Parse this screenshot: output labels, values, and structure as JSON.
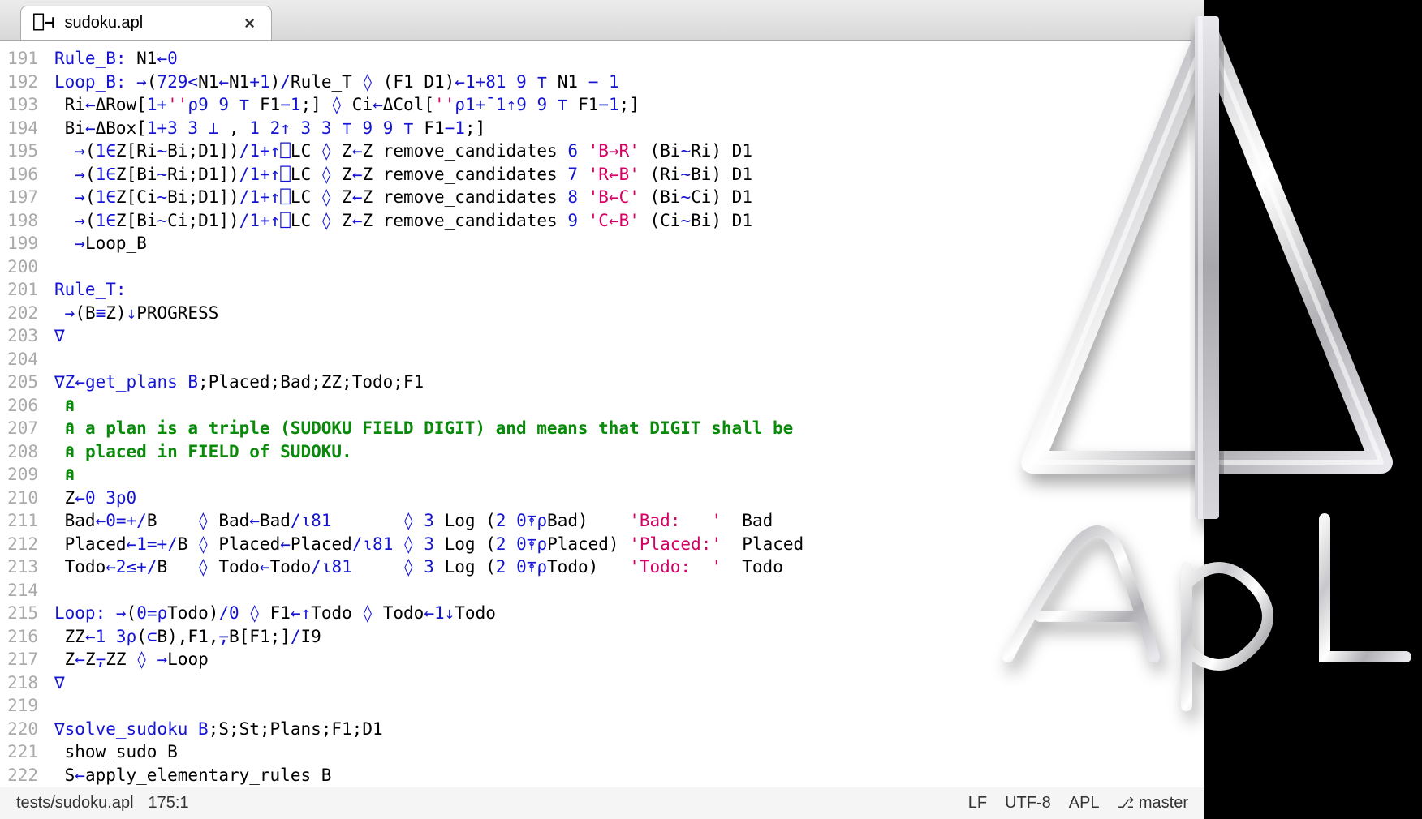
{
  "tab": {
    "icon": "⎕⊣",
    "filename": "sudoku.apl",
    "close": "×"
  },
  "lines": [
    {
      "n": 191,
      "segs": [
        [
          "label",
          "Rule_B:"
        ],
        [
          "plain",
          " N1"
        ],
        [
          "asn",
          "←"
        ],
        [
          "num",
          "0"
        ]
      ]
    },
    {
      "n": 192,
      "segs": [
        [
          "label",
          "Loop_B:"
        ],
        [
          "plain",
          " "
        ],
        [
          "op",
          "→"
        ],
        [
          "plain",
          "("
        ],
        [
          "num",
          "729"
        ],
        [
          "op",
          "<"
        ],
        [
          "plain",
          "N1"
        ],
        [
          "asn",
          "←"
        ],
        [
          "plain",
          "N1"
        ],
        [
          "op",
          "+"
        ],
        [
          "num",
          "1"
        ],
        [
          "plain",
          ")"
        ],
        [
          "op",
          "/"
        ],
        [
          "plain",
          "Rule_T "
        ],
        [
          "op",
          "◊"
        ],
        [
          "plain",
          " (F1 D1)"
        ],
        [
          "asn",
          "←"
        ],
        [
          "num",
          "1"
        ],
        [
          "op",
          "+"
        ],
        [
          "num",
          "81 9 "
        ],
        [
          "op",
          "⊤"
        ],
        [
          "plain",
          " N1 "
        ],
        [
          "op",
          "−"
        ],
        [
          "plain",
          " "
        ],
        [
          "num",
          "1"
        ]
      ]
    },
    {
      "n": 193,
      "segs": [
        [
          "plain",
          " Ri"
        ],
        [
          "asn",
          "←"
        ],
        [
          "plain",
          "ΔRow["
        ],
        [
          "num",
          "1"
        ],
        [
          "op",
          "+"
        ],
        [
          "str",
          "''"
        ],
        [
          "op",
          "⍴"
        ],
        [
          "num",
          "9 9 "
        ],
        [
          "op",
          "⊤"
        ],
        [
          "plain",
          " F1"
        ],
        [
          "op",
          "−"
        ],
        [
          "num",
          "1"
        ],
        [
          "plain",
          ";] "
        ],
        [
          "op",
          "◊"
        ],
        [
          "plain",
          " Ci"
        ],
        [
          "asn",
          "←"
        ],
        [
          "plain",
          "ΔCol["
        ],
        [
          "str",
          "''"
        ],
        [
          "op",
          "⍴"
        ],
        [
          "num",
          "1"
        ],
        [
          "op",
          "+¯"
        ],
        [
          "num",
          "1"
        ],
        [
          "op",
          "↑"
        ],
        [
          "num",
          "9 9 "
        ],
        [
          "op",
          "⊤"
        ],
        [
          "plain",
          " F1"
        ],
        [
          "op",
          "−"
        ],
        [
          "num",
          "1"
        ],
        [
          "plain",
          ";]"
        ]
      ]
    },
    {
      "n": 194,
      "segs": [
        [
          "plain",
          " Bi"
        ],
        [
          "asn",
          "←"
        ],
        [
          "plain",
          "ΔBox["
        ],
        [
          "num",
          "1"
        ],
        [
          "op",
          "+"
        ],
        [
          "num",
          "3 3 "
        ],
        [
          "op",
          "⊥"
        ],
        [
          "plain",
          " , "
        ],
        [
          "num",
          "1 2"
        ],
        [
          "op",
          "↑"
        ],
        [
          "plain",
          " "
        ],
        [
          "num",
          "3 3 "
        ],
        [
          "op",
          "⊤"
        ],
        [
          "plain",
          " "
        ],
        [
          "num",
          "9 9 "
        ],
        [
          "op",
          "⊤"
        ],
        [
          "plain",
          " F1"
        ],
        [
          "op",
          "−"
        ],
        [
          "num",
          "1"
        ],
        [
          "plain",
          ";]"
        ]
      ]
    },
    {
      "n": 195,
      "segs": [
        [
          "plain",
          "  "
        ],
        [
          "op",
          "→"
        ],
        [
          "plain",
          "("
        ],
        [
          "num",
          "1"
        ],
        [
          "op",
          "∈"
        ],
        [
          "plain",
          "Z[Ri"
        ],
        [
          "op",
          "~"
        ],
        [
          "plain",
          "Bi;D1])"
        ],
        [
          "op",
          "/"
        ],
        [
          "num",
          "1"
        ],
        [
          "op",
          "+↑⎕"
        ],
        [
          "plain",
          "LC "
        ],
        [
          "op",
          "◊"
        ],
        [
          "plain",
          " Z"
        ],
        [
          "asn",
          "←"
        ],
        [
          "plain",
          "Z remove_candidates "
        ],
        [
          "num",
          "6"
        ],
        [
          "plain",
          " "
        ],
        [
          "str",
          "'B→R'"
        ],
        [
          "plain",
          " (Bi"
        ],
        [
          "op",
          "~"
        ],
        [
          "plain",
          "Ri) D1"
        ]
      ]
    },
    {
      "n": 196,
      "segs": [
        [
          "plain",
          "  "
        ],
        [
          "op",
          "→"
        ],
        [
          "plain",
          "("
        ],
        [
          "num",
          "1"
        ],
        [
          "op",
          "∈"
        ],
        [
          "plain",
          "Z[Bi"
        ],
        [
          "op",
          "~"
        ],
        [
          "plain",
          "Ri;D1])"
        ],
        [
          "op",
          "/"
        ],
        [
          "num",
          "1"
        ],
        [
          "op",
          "+↑⎕"
        ],
        [
          "plain",
          "LC "
        ],
        [
          "op",
          "◊"
        ],
        [
          "plain",
          " Z"
        ],
        [
          "asn",
          "←"
        ],
        [
          "plain",
          "Z remove_candidates "
        ],
        [
          "num",
          "7"
        ],
        [
          "plain",
          " "
        ],
        [
          "str",
          "'R←B'"
        ],
        [
          "plain",
          " (Ri"
        ],
        [
          "op",
          "~"
        ],
        [
          "plain",
          "Bi) D1"
        ]
      ]
    },
    {
      "n": 197,
      "segs": [
        [
          "plain",
          "  "
        ],
        [
          "op",
          "→"
        ],
        [
          "plain",
          "("
        ],
        [
          "num",
          "1"
        ],
        [
          "op",
          "∈"
        ],
        [
          "plain",
          "Z[Ci"
        ],
        [
          "op",
          "~"
        ],
        [
          "plain",
          "Bi;D1])"
        ],
        [
          "op",
          "/"
        ],
        [
          "num",
          "1"
        ],
        [
          "op",
          "+↑⎕"
        ],
        [
          "plain",
          "LC "
        ],
        [
          "op",
          "◊"
        ],
        [
          "plain",
          " Z"
        ],
        [
          "asn",
          "←"
        ],
        [
          "plain",
          "Z remove_candidates "
        ],
        [
          "num",
          "8"
        ],
        [
          "plain",
          " "
        ],
        [
          "str",
          "'B←C'"
        ],
        [
          "plain",
          " (Bi"
        ],
        [
          "op",
          "~"
        ],
        [
          "plain",
          "Ci) D1"
        ]
      ]
    },
    {
      "n": 198,
      "segs": [
        [
          "plain",
          "  "
        ],
        [
          "op",
          "→"
        ],
        [
          "plain",
          "("
        ],
        [
          "num",
          "1"
        ],
        [
          "op",
          "∈"
        ],
        [
          "plain",
          "Z[Bi"
        ],
        [
          "op",
          "~"
        ],
        [
          "plain",
          "Ci;D1])"
        ],
        [
          "op",
          "/"
        ],
        [
          "num",
          "1"
        ],
        [
          "op",
          "+↑⎕"
        ],
        [
          "plain",
          "LC "
        ],
        [
          "op",
          "◊"
        ],
        [
          "plain",
          " Z"
        ],
        [
          "asn",
          "←"
        ],
        [
          "plain",
          "Z remove_candidates "
        ],
        [
          "num",
          "9"
        ],
        [
          "plain",
          " "
        ],
        [
          "str",
          "'C←B'"
        ],
        [
          "plain",
          " (Ci"
        ],
        [
          "op",
          "~"
        ],
        [
          "plain",
          "Bi) D1"
        ]
      ]
    },
    {
      "n": 199,
      "segs": [
        [
          "plain",
          "  "
        ],
        [
          "op",
          "→"
        ],
        [
          "plain",
          "Loop_B"
        ]
      ]
    },
    {
      "n": 200,
      "segs": [
        [
          "plain",
          ""
        ]
      ]
    },
    {
      "n": 201,
      "segs": [
        [
          "label",
          "Rule_T:"
        ]
      ]
    },
    {
      "n": 202,
      "segs": [
        [
          "plain",
          " "
        ],
        [
          "op",
          "→"
        ],
        [
          "plain",
          "(B"
        ],
        [
          "op",
          "≡"
        ],
        [
          "plain",
          "Z)"
        ],
        [
          "op",
          "↓"
        ],
        [
          "plain",
          "PROGRESS"
        ]
      ]
    },
    {
      "n": 203,
      "segs": [
        [
          "nabla",
          "∇"
        ]
      ]
    },
    {
      "n": 204,
      "segs": [
        [
          "plain",
          ""
        ]
      ]
    },
    {
      "n": 205,
      "segs": [
        [
          "nabla",
          "∇"
        ],
        [
          "kw",
          "Z"
        ],
        [
          "asn",
          "←"
        ],
        [
          "kw",
          "get_plans B"
        ],
        [
          "plain",
          ";Placed;Bad;ZZ;Todo;F1"
        ]
      ]
    },
    {
      "n": 206,
      "segs": [
        [
          "plain",
          " "
        ],
        [
          "cmt",
          "⍝"
        ]
      ]
    },
    {
      "n": 207,
      "segs": [
        [
          "plain",
          " "
        ],
        [
          "cmt",
          "⍝ a plan is a triple (SUDOKU FIELD DIGIT) and means that DIGIT shall be"
        ]
      ]
    },
    {
      "n": 208,
      "segs": [
        [
          "plain",
          " "
        ],
        [
          "cmt",
          "⍝ placed in FIELD of SUDOKU."
        ]
      ]
    },
    {
      "n": 209,
      "segs": [
        [
          "plain",
          " "
        ],
        [
          "cmt",
          "⍝"
        ]
      ]
    },
    {
      "n": 210,
      "segs": [
        [
          "plain",
          " Z"
        ],
        [
          "asn",
          "←"
        ],
        [
          "num",
          "0 3"
        ],
        [
          "op",
          "⍴"
        ],
        [
          "num",
          "0"
        ]
      ]
    },
    {
      "n": 211,
      "segs": [
        [
          "plain",
          " Bad"
        ],
        [
          "asn",
          "←"
        ],
        [
          "num",
          "0"
        ],
        [
          "op",
          "=+/"
        ],
        [
          "plain",
          "B    "
        ],
        [
          "op",
          "◊"
        ],
        [
          "plain",
          " Bad"
        ],
        [
          "asn",
          "←"
        ],
        [
          "plain",
          "Bad"
        ],
        [
          "op",
          "/⍳"
        ],
        [
          "num",
          "81"
        ],
        [
          "plain",
          "       "
        ],
        [
          "op",
          "◊"
        ],
        [
          "plain",
          " "
        ],
        [
          "num",
          "3"
        ],
        [
          "plain",
          " Log ("
        ],
        [
          "num",
          "2 0"
        ],
        [
          "op",
          "⍕⍴"
        ],
        [
          "plain",
          "Bad)    "
        ],
        [
          "str",
          "'Bad:   '"
        ],
        [
          "plain",
          "  Bad"
        ]
      ]
    },
    {
      "n": 212,
      "segs": [
        [
          "plain",
          " Placed"
        ],
        [
          "asn",
          "←"
        ],
        [
          "num",
          "1"
        ],
        [
          "op",
          "=+/"
        ],
        [
          "plain",
          "B "
        ],
        [
          "op",
          "◊"
        ],
        [
          "plain",
          " Placed"
        ],
        [
          "asn",
          "←"
        ],
        [
          "plain",
          "Placed"
        ],
        [
          "op",
          "/⍳"
        ],
        [
          "num",
          "81"
        ],
        [
          "plain",
          " "
        ],
        [
          "op",
          "◊"
        ],
        [
          "plain",
          " "
        ],
        [
          "num",
          "3"
        ],
        [
          "plain",
          " Log ("
        ],
        [
          "num",
          "2 0"
        ],
        [
          "op",
          "⍕⍴"
        ],
        [
          "plain",
          "Placed) "
        ],
        [
          "str",
          "'Placed:'"
        ],
        [
          "plain",
          "  Placed"
        ]
      ]
    },
    {
      "n": 213,
      "segs": [
        [
          "plain",
          " Todo"
        ],
        [
          "asn",
          "←"
        ],
        [
          "num",
          "2"
        ],
        [
          "op",
          "≤+/"
        ],
        [
          "plain",
          "B   "
        ],
        [
          "op",
          "◊"
        ],
        [
          "plain",
          " Todo"
        ],
        [
          "asn",
          "←"
        ],
        [
          "plain",
          "Todo"
        ],
        [
          "op",
          "/⍳"
        ],
        [
          "num",
          "81"
        ],
        [
          "plain",
          "     "
        ],
        [
          "op",
          "◊"
        ],
        [
          "plain",
          " "
        ],
        [
          "num",
          "3"
        ],
        [
          "plain",
          " Log ("
        ],
        [
          "num",
          "2 0"
        ],
        [
          "op",
          "⍕⍴"
        ],
        [
          "plain",
          "Todo)   "
        ],
        [
          "str",
          "'Todo:  '"
        ],
        [
          "plain",
          "  Todo"
        ]
      ]
    },
    {
      "n": 214,
      "segs": [
        [
          "plain",
          ""
        ]
      ]
    },
    {
      "n": 215,
      "segs": [
        [
          "label",
          "Loop:"
        ],
        [
          "plain",
          " "
        ],
        [
          "op",
          "→"
        ],
        [
          "plain",
          "("
        ],
        [
          "num",
          "0"
        ],
        [
          "op",
          "=⍴"
        ],
        [
          "plain",
          "Todo)"
        ],
        [
          "op",
          "/"
        ],
        [
          "num",
          "0"
        ],
        [
          "plain",
          " "
        ],
        [
          "op",
          "◊"
        ],
        [
          "plain",
          " F1"
        ],
        [
          "asn",
          "←↑"
        ],
        [
          "plain",
          "Todo "
        ],
        [
          "op",
          "◊"
        ],
        [
          "plain",
          " Todo"
        ],
        [
          "asn",
          "←"
        ],
        [
          "num",
          "1"
        ],
        [
          "op",
          "↓"
        ],
        [
          "plain",
          "Todo"
        ]
      ]
    },
    {
      "n": 216,
      "segs": [
        [
          "plain",
          " ZZ"
        ],
        [
          "asn",
          "←"
        ],
        [
          "num",
          "1 3"
        ],
        [
          "op",
          "⍴"
        ],
        [
          "plain",
          "("
        ],
        [
          "op",
          "⊂"
        ],
        [
          "plain",
          "B),F1,"
        ],
        [
          "op",
          "⍪"
        ],
        [
          "plain",
          "B[F1;]"
        ],
        [
          "op",
          "/"
        ],
        [
          "plain",
          "I9"
        ]
      ]
    },
    {
      "n": 217,
      "segs": [
        [
          "plain",
          " Z"
        ],
        [
          "asn",
          "←"
        ],
        [
          "plain",
          "Z"
        ],
        [
          "op",
          "⍪"
        ],
        [
          "plain",
          "ZZ "
        ],
        [
          "op",
          "◊"
        ],
        [
          "plain",
          " "
        ],
        [
          "op",
          "→"
        ],
        [
          "plain",
          "Loop"
        ]
      ]
    },
    {
      "n": 218,
      "segs": [
        [
          "nabla",
          "∇"
        ]
      ]
    },
    {
      "n": 219,
      "segs": [
        [
          "plain",
          ""
        ]
      ]
    },
    {
      "n": 220,
      "segs": [
        [
          "nabla",
          "∇"
        ],
        [
          "kw",
          "solve_sudoku B"
        ],
        [
          "plain",
          ";S;St;Plans;F1;D1"
        ]
      ]
    },
    {
      "n": 221,
      "segs": [
        [
          "plain",
          " show_sudo B"
        ]
      ]
    },
    {
      "n": 222,
      "segs": [
        [
          "plain",
          " S"
        ],
        [
          "asn",
          "←"
        ],
        [
          "plain",
          "apply_elementary_rules B"
        ]
      ]
    }
  ],
  "status": {
    "path": "tests/sudoku.apl",
    "cursor": "175:1",
    "eol": "LF",
    "encoding": "UTF-8",
    "lang": "APL",
    "branch": "master"
  }
}
